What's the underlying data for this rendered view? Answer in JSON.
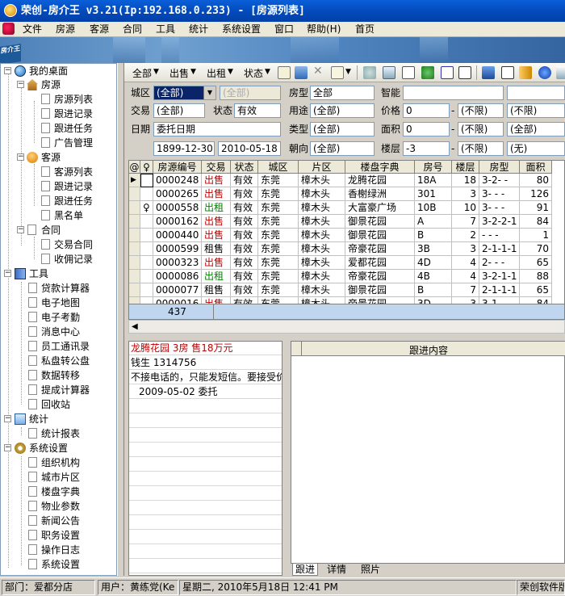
{
  "window": {
    "title": "荣创-房介王 v3.21(Ip:192.168.0.233) - [房源列表]"
  },
  "menu": [
    "文件",
    "房源",
    "客源",
    "合同",
    "工具",
    "统计",
    "系统设置",
    "窗口",
    "帮助(H)",
    "首页"
  ],
  "banner": {
    "logo_text": "房介王"
  },
  "tree": {
    "root": "我的桌面",
    "groups": [
      {
        "label": "房源",
        "items": [
          "房源列表",
          "跟进记录",
          "跟进任务",
          "广告管理"
        ]
      },
      {
        "label": "客源",
        "items": [
          "客源列表",
          "跟进记录",
          "跟进任务",
          "黑名单"
        ]
      },
      {
        "label": "合同",
        "items": [
          "交易合同",
          "收佣记录"
        ]
      }
    ],
    "tools": {
      "label": "工具",
      "items": [
        "贷款计算器",
        "电子地图",
        "电子考勤",
        "消息中心",
        "员工通讯录",
        "私盘转公盘",
        "数据转移",
        "提成计算器",
        "回收站"
      ]
    },
    "stats": {
      "label": "统计",
      "items": [
        "统计报表"
      ]
    },
    "settings": {
      "label": "系统设置",
      "items": [
        "组织机构",
        "城市片区",
        "楼盘字典",
        "物业参数",
        "新闻公告",
        "职务设置",
        "操作日志",
        "系统设置"
      ]
    }
  },
  "toolbar": {
    "all": "全部",
    "sale": "出售",
    "rent": "出租",
    "status": "状态"
  },
  "filters": {
    "city_label": "城区",
    "city_value": "(全部)",
    "area_value": "(全部)",
    "house_type_label": "房型",
    "house_type_value": "全部",
    "smart_label": "智能",
    "trade_label": "交易",
    "trade_value": "(全部)",
    "status_label": "状态",
    "status_value": "有效",
    "usage_label": "用途",
    "usage_value": "(全部)",
    "price_label": "价格",
    "price_min": "0",
    "price_max": "(不限)",
    "price_unit": "(不限)",
    "date_label": "日期",
    "date_value": "委托日期",
    "kind_label": "类型",
    "kind_value": "(全部)",
    "size_label": "面积",
    "size_min": "0",
    "size_max": "(不限)",
    "size_unit": "(全部)",
    "date_from": "1899-12-30",
    "date_to": "2010-05-18",
    "facing_label": "朝向",
    "facing_value": "(全部)",
    "floor_label": "楼层",
    "floor_min": "-3",
    "floor_max": "(不限)",
    "floor_extra": "(无)",
    "range_sep": "-"
  },
  "grid": {
    "headers": [
      "@",
      "♀",
      "房源编号",
      "交易",
      "状态",
      "城区",
      "片区",
      "楼盘字典",
      "房号",
      "楼层",
      "房型",
      "面积"
    ],
    "rows": [
      {
        "key": "",
        "id": "0000248",
        "trade": "出售",
        "status": "有效",
        "city": "东莞",
        "zone": "樟木头",
        "estate": "龙腾花园",
        "room": "18A",
        "floor": "18",
        "layout": "3-2- -",
        "area": "80"
      },
      {
        "key": "",
        "id": "0000265",
        "trade": "出售",
        "status": "有效",
        "city": "东莞",
        "zone": "樟木头",
        "estate": "香榭绿洲",
        "room": "301",
        "floor": "3",
        "layout": "3- - -",
        "area": "126"
      },
      {
        "key": "♀",
        "id": "0000558",
        "trade": "出租",
        "status": "有效",
        "city": "东莞",
        "zone": "樟木头",
        "estate": "大富豪广场",
        "room": "10B",
        "floor": "10",
        "layout": "3- - -",
        "area": "91"
      },
      {
        "key": "",
        "id": "0000162",
        "trade": "出售",
        "status": "有效",
        "city": "东莞",
        "zone": "樟木头",
        "estate": "御景花园",
        "room": "A",
        "floor": "7",
        "layout": "3-2-2-1",
        "area": "84"
      },
      {
        "key": "",
        "id": "0000440",
        "trade": "出售",
        "status": "有效",
        "city": "东莞",
        "zone": "樟木头",
        "estate": "御景花园",
        "room": "B",
        "floor": "2",
        "layout": "- - -",
        "area": "1"
      },
      {
        "key": "",
        "id": "0000599",
        "trade": "租售",
        "status": "有效",
        "city": "东莞",
        "zone": "樟木头",
        "estate": "帝豪花园",
        "room": "3B",
        "floor": "3",
        "layout": "2-1-1-1",
        "area": "70"
      },
      {
        "key": "",
        "id": "0000323",
        "trade": "出售",
        "status": "有效",
        "city": "东莞",
        "zone": "樟木头",
        "estate": "爱都花园",
        "room": "4D",
        "floor": "4",
        "layout": "2- - -",
        "area": "65"
      },
      {
        "key": "",
        "id": "0000086",
        "trade": "出租",
        "status": "有效",
        "city": "东莞",
        "zone": "樟木头",
        "estate": "帝豪花园",
        "room": "4B",
        "floor": "4",
        "layout": "3-2-1-1",
        "area": "88"
      },
      {
        "key": "",
        "id": "0000077",
        "trade": "租售",
        "status": "有效",
        "city": "东莞",
        "zone": "樟木头",
        "estate": "御景花园",
        "room": "B",
        "floor": "7",
        "layout": "2-1-1-1",
        "area": "65"
      },
      {
        "key": "",
        "id": "0000016",
        "trade": "出售",
        "status": "有效",
        "city": "东莞",
        "zone": "樟木头",
        "estate": "帝景花园",
        "room": "3D",
        "floor": "3",
        "layout": "3-1- -",
        "area": "84"
      }
    ],
    "total": "437"
  },
  "detail": {
    "headline": "龙腾花园 3房 售18万元",
    "contact": "钱生 1314756",
    "note": "不接电话的，只能发短信。要接受价",
    "entry": "2009-05-02 委托"
  },
  "follow": {
    "header": "跟进内容",
    "tabs": [
      "跟进",
      "详情",
      "照片"
    ]
  },
  "status": {
    "dept": "部门：爱都分店",
    "user": "用户：黄练党(Ke",
    "datetime": "星期二, 2010年5月18日 12:41 PM",
    "brand": "荣创软件版"
  },
  "colors": {
    "title_bar": "#0348b8",
    "sale": "#c00000",
    "rent": "#008000",
    "selected": "#0a246a"
  }
}
